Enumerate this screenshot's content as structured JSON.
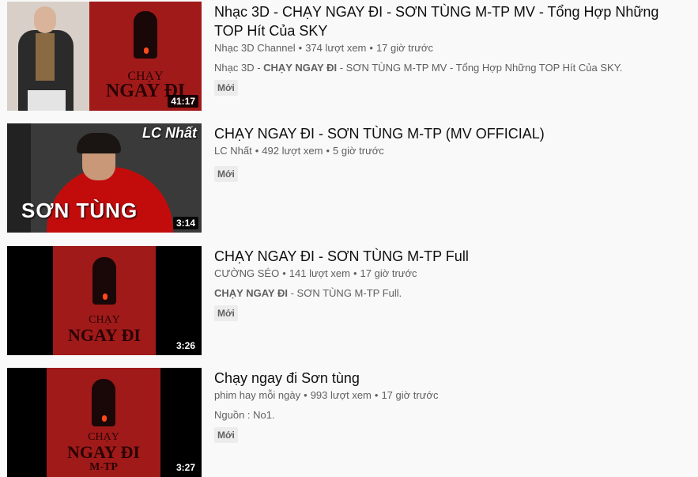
{
  "results": [
    {
      "title": "Nhạc 3D - CHẠY NGAY ĐI - SƠN TÙNG M-TP MV - Tổng Hợp Những TOP Hít Của SKY",
      "channel": "Nhạc 3D Channel",
      "views": "374 lượt xem",
      "age": "17 giờ trước",
      "desc_pre": "Nhạc 3D - ",
      "desc_bold": "CHẠY NGAY ĐI",
      "desc_post": " - SƠN TÙNG M-TP MV - Tổng Hợp Những TOP Hít Của SKY.",
      "badge": "Mới",
      "duration": "41:17",
      "poster_line1": "CHẠY",
      "poster_line2": "NGAY ĐI"
    },
    {
      "title": "CHẠY NGAY ĐI - SƠN TÙNG M-TP (MV OFFICIAL)",
      "channel": "LC Nhất",
      "views": "492 lượt xem",
      "age": "5 giờ trước",
      "badge": "Mới",
      "duration": "3:14",
      "thumb_name": "SƠN TÙNG",
      "thumb_logo": "LC Nhất"
    },
    {
      "title": "CHẠY NGAY ĐI - SƠN TÙNG M-TP Full",
      "channel": "CƯỜNG SÉO",
      "views": "141 lượt xem",
      "age": "17 giờ trước",
      "desc_pre": "",
      "desc_bold": "CHẠY NGAY ĐI",
      "desc_post": " - SƠN TÙNG M-TP Full.",
      "badge": "Mới",
      "duration": "3:26",
      "poster_line1": "CHẠY",
      "poster_line2": "NGAY ĐI"
    },
    {
      "title": "Chạy ngay đi Sơn tùng",
      "channel": "phim hay mỗi ngày",
      "views": "993 lượt xem",
      "age": "17 giờ trước",
      "desc_pre": "Nguồn : No1.",
      "badge": "Mới",
      "duration": "3:27",
      "poster_line1": "CHẠY",
      "poster_line2": "NGAY ĐI",
      "poster_line3": "M-TP"
    }
  ],
  "separator": "•",
  "colors": {
    "poster_red": "#a01a1a",
    "cape_red": "#c20c0c",
    "meta_gray": "#606060"
  }
}
